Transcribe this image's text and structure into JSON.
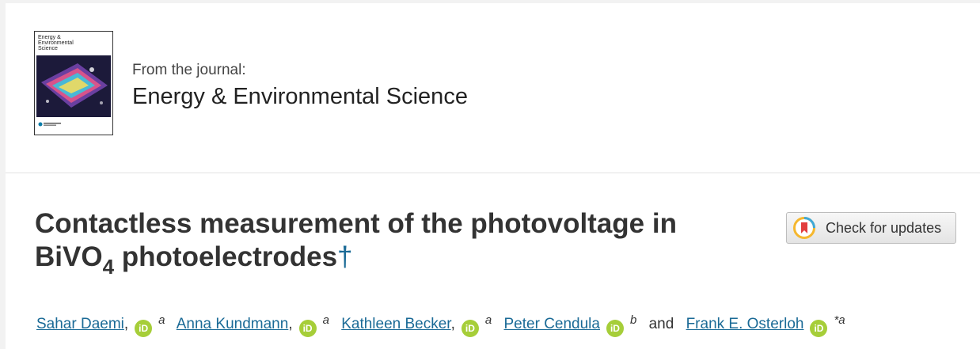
{
  "journal": {
    "cover_title": "Energy & Environmental Science",
    "from_label": "From the journal:",
    "name": "Energy & Environmental Science"
  },
  "article": {
    "title_part1": "Contactless measurement of the photovoltage in",
    "title_part2_prefix": "BiVO",
    "title_subscript": "4",
    "title_part2_suffix": " photoelectrodes",
    "footnote_marker": "†"
  },
  "check_updates": {
    "label": "Check for updates"
  },
  "authors": [
    {
      "name": "Sahar Daemi",
      "orcid": "iD",
      "affiliation": "a",
      "separator": ","
    },
    {
      "name": "Anna Kundmann",
      "orcid": "iD",
      "affiliation": "a",
      "separator": ","
    },
    {
      "name": "Kathleen Becker",
      "orcid": "iD",
      "affiliation": "a",
      "separator": ","
    },
    {
      "name": "Peter Cendula",
      "orcid": "iD",
      "affiliation": "b",
      "separator": ""
    },
    {
      "name": "Frank E. Osterloh",
      "orcid": "iD",
      "affiliation": "*a",
      "separator": ""
    }
  ],
  "authors_conjunction": "and",
  "icons": {
    "cover": "journal-cover-image",
    "orcid": "orcid-icon",
    "crossmark": "crossmark-icon"
  },
  "colors": {
    "link": "#1a6a96",
    "orcid": "#a6ce39",
    "text": "#333333"
  }
}
